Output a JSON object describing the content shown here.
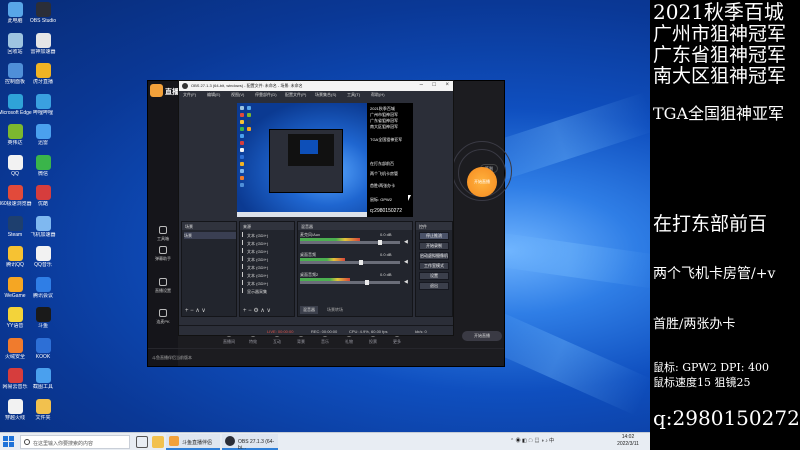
{
  "desktop": {
    "icons": [
      {
        "label": "此电脑",
        "color": "#58a6e8"
      },
      {
        "label": "回收站",
        "color": "#9ec4e0"
      },
      {
        "label": "控制面板",
        "color": "#4f8fd8"
      },
      {
        "label": "Microsoft Edge",
        "color": "#2fa3d8"
      },
      {
        "label": "英伟达",
        "color": "#7cb82f"
      },
      {
        "label": "QQ",
        "color": "#f2f2f2"
      },
      {
        "label": "360极速浏览器",
        "color": "#e24a3a"
      },
      {
        "label": "Steam",
        "color": "#1e3f6e"
      },
      {
        "label": "腾讯QQ",
        "color": "#f6c233"
      },
      {
        "label": "WeGame",
        "color": "#f5a623"
      },
      {
        "label": "YY语音",
        "color": "#f3d33a"
      },
      {
        "label": "火绒安全",
        "color": "#f07b2d"
      },
      {
        "label": "网易云音乐",
        "color": "#d63d3d"
      },
      {
        "label": "穿越火线",
        "color": "#f2f2f2"
      },
      {
        "label": "OBS Studio",
        "color": "#2b2e38"
      },
      {
        "label": "雷神加速器",
        "color": "#e6e6e6"
      },
      {
        "label": "虎牙直播",
        "color": "#f0b323"
      },
      {
        "label": "哔哩哔哩",
        "color": "#3aa0e0"
      },
      {
        "label": "迅雷",
        "color": "#4aa0ee"
      },
      {
        "label": "微信",
        "color": "#3ab54a"
      },
      {
        "label": "优酷",
        "color": "#d63d3d"
      },
      {
        "label": "飞机加速器",
        "color": "#7fb8f0"
      },
      {
        "label": "QQ音乐",
        "color": "#f2f2f2"
      },
      {
        "label": "腾讯会议",
        "color": "#2f7ee6"
      },
      {
        "label": "斗鱼",
        "color": "#1a1a1a"
      },
      {
        "label": "KOOK",
        "color": "#2d6fd6"
      },
      {
        "label": "截图工具",
        "color": "#4aa0ee"
      },
      {
        "label": "文件夹",
        "color": "#f2c14e"
      }
    ]
  },
  "taskbar": {
    "search_placeholder": "在这里输入你要搜索的内容",
    "apps": [
      {
        "label": "斗鱼直播伴侣",
        "color": "#f2a13b"
      },
      {
        "label": "OBS 27.1.3 (64-bi...",
        "color": "#2b2e38"
      }
    ],
    "time": "14:02",
    "date": "2022/3/11"
  },
  "streamer_app": {
    "brand": "直播伴侣",
    "sidebar": [
      "工具箱",
      "弹幕助手",
      "直播设置",
      "连麦PK"
    ],
    "start_label": "开始直播",
    "checkin_label": "签到",
    "bottom_items": [
      "直播间",
      "特效",
      "互动",
      "背景",
      "音乐",
      "礼物",
      "投票",
      "更多"
    ],
    "pill_label": "开始直播",
    "footer_text": "斗鱼直播伴侣当前版本"
  },
  "obs": {
    "title": "OBS 27.1.3 (64-bit, windows) - 配置文件: 未命名 - 场景: 未命名",
    "menu": [
      "文件(F)",
      "编辑(E)",
      "视图(V)",
      "停靠部件(D)",
      "配置文件(P)",
      "场景集合(S)",
      "工具(T)",
      "帮助(H)"
    ],
    "preview_side_lines": [
      "2021秋季百城",
      "广州市狙神冠军",
      "广东省狙神冠军",
      "南大区狙神冠军",
      "TGA全国狙神亚军",
      "在打东部前百",
      "两个飞机卡房管",
      "首胜/两张办卡",
      "鼠标: GPW2",
      "q:2980150272"
    ],
    "scene_header": "场景",
    "sources_header": "来源",
    "scene_item": "场景",
    "sources": [
      "文本 (GDI+)",
      "文本 (GDI+)",
      "文本 (GDI+)",
      "文本 (GDI+)",
      "文本 (GDI+)",
      "文本 (GDI+)",
      "文本 (GDI+)",
      "显示器采集"
    ],
    "mixer_header": "混音器",
    "mixer": [
      {
        "name": "麦克风/Aux",
        "level": "0.0 dB",
        "fill": 0.6
      },
      {
        "name": "桌面音频",
        "level": "0.0 dB",
        "fill": 0.45
      },
      {
        "name": "桌面音频2",
        "level": "0.0 dB",
        "fill": 0.5
      }
    ],
    "controls_header": "控件",
    "controls": [
      "停止推流",
      "开始录制",
      "启动虚拟摄像机",
      "工作室模式",
      "设置",
      "退出"
    ],
    "transition_tabs": [
      "混音器",
      "场景转场"
    ],
    "status": {
      "live": "LIVE: 00:00:00",
      "rec": "REC: 00:00:00",
      "cpu": "CPU: 4.9%, 60.00 fps",
      "kbps": "kb/s: 0"
    }
  },
  "overlay": {
    "lines": [
      "2021秋季百城",
      "广州市狙神冠军",
      "广东省狙神冠军",
      "南大区狙神冠军",
      "TGA全国狙神亚军",
      "在打东部前百",
      "两个飞机卡房管/+v",
      "首胜/两张办卡",
      "鼠标:  GPW2  DPI:  400",
      "鼠标速度15  狙镜25",
      "q:2980150272"
    ]
  }
}
